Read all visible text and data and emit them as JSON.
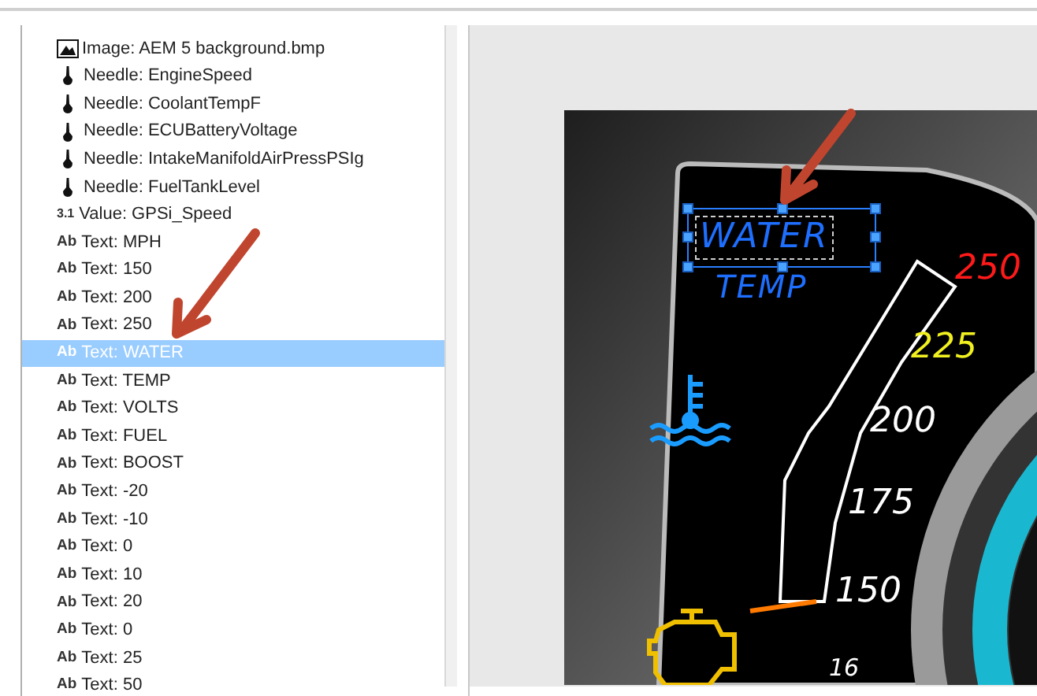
{
  "tree": {
    "items": [
      {
        "kind": "image",
        "label": "Image: AEM 5 background.bmp",
        "selected": false
      },
      {
        "kind": "needle",
        "label": "Needle: EngineSpeed",
        "selected": false
      },
      {
        "kind": "needle",
        "label": "Needle: CoolantTempF",
        "selected": false
      },
      {
        "kind": "needle",
        "label": "Needle: ECUBatteryVoltage",
        "selected": false
      },
      {
        "kind": "needle",
        "label": "Needle: IntakeManifoldAirPressPSIg",
        "selected": false
      },
      {
        "kind": "needle",
        "label": "Needle: FuelTankLevel",
        "selected": false
      },
      {
        "kind": "value",
        "icon": "3.1",
        "label": "Value: GPSi_Speed",
        "selected": false
      },
      {
        "kind": "text",
        "icon": "Ab",
        "label": "Text: MPH",
        "selected": false
      },
      {
        "kind": "text",
        "icon": "Ab",
        "label": "Text: 150",
        "selected": false
      },
      {
        "kind": "text",
        "icon": "Ab",
        "label": "Text: 200",
        "selected": false
      },
      {
        "kind": "text",
        "icon": "Ab",
        "label": "Text: 250",
        "selected": false
      },
      {
        "kind": "text",
        "icon": "Ab",
        "label": "Text: WATER",
        "selected": true
      },
      {
        "kind": "text",
        "icon": "Ab",
        "label": "Text: TEMP",
        "selected": false
      },
      {
        "kind": "text",
        "icon": "Ab",
        "label": "Text: VOLTS",
        "selected": false
      },
      {
        "kind": "text",
        "icon": "Ab",
        "label": "Text: FUEL",
        "selected": false
      },
      {
        "kind": "text",
        "icon": "Ab",
        "label": "Text: BOOST",
        "selected": false
      },
      {
        "kind": "text",
        "icon": "Ab",
        "label": "Text: -20",
        "selected": false
      },
      {
        "kind": "text",
        "icon": "Ab",
        "label": "Text: -10",
        "selected": false
      },
      {
        "kind": "text",
        "icon": "Ab",
        "label": "Text: 0",
        "selected": false
      },
      {
        "kind": "text",
        "icon": "Ab",
        "label": "Text: 10",
        "selected": false
      },
      {
        "kind": "text",
        "icon": "Ab",
        "label": "Text: 20",
        "selected": false
      },
      {
        "kind": "text",
        "icon": "Ab",
        "label": "Text: 0",
        "selected": false
      },
      {
        "kind": "text",
        "icon": "Ab",
        "label": "Text: 25",
        "selected": false
      },
      {
        "kind": "text",
        "icon": "Ab",
        "label": "Text: 50",
        "selected": false
      }
    ]
  },
  "canvas": {
    "labels": [
      {
        "text": "WATER",
        "color": "#1e6fff",
        "selected": true
      },
      {
        "text": "TEMP",
        "color": "#1e6fff"
      },
      {
        "text": "250",
        "color": "#ff1a1a"
      },
      {
        "text": "225",
        "color": "#f0f020"
      },
      {
        "text": "200",
        "color": "#ffffff"
      },
      {
        "text": "175",
        "color": "#ffffff"
      },
      {
        "text": "150",
        "color": "#ffffff"
      },
      {
        "text": "16",
        "color": "#ffffff"
      }
    ]
  }
}
